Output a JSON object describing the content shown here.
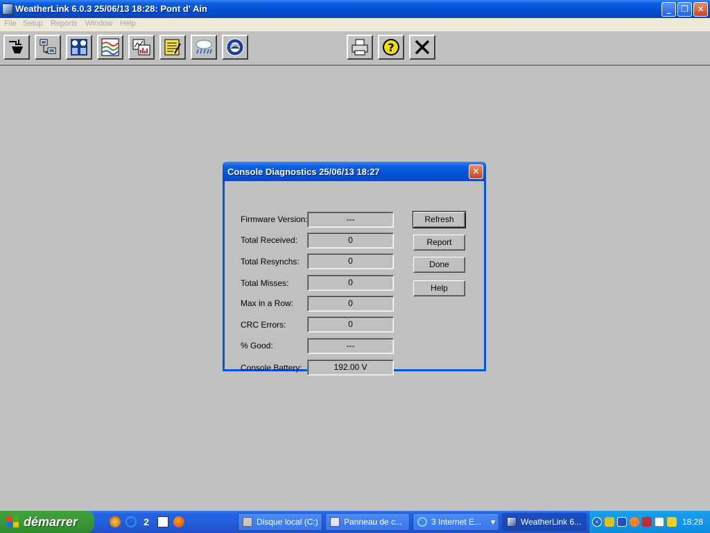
{
  "window": {
    "title": "WeatherLink 6.0.3  25/06/13  18:28: Pont d' Ain",
    "controls": {
      "minimize": "_",
      "restore": "❐",
      "close": "✕"
    }
  },
  "menu": [
    "File",
    "Setup",
    "Reports",
    "Window",
    "Help"
  ],
  "toolbar": {
    "left_icons": [
      "connect-icon",
      "download-icon",
      "bulletin-icon",
      "summary-graph-icon",
      "plot-graph-icon",
      "notes-icon",
      "rain-icon",
      "noaa-icon"
    ],
    "right_icons": [
      "print-icon",
      "help-icon",
      "exit-icon"
    ],
    "help_glyph": "?",
    "exit_glyph": "✕",
    "noaa_label": "NOAA"
  },
  "dialog": {
    "title": "Console Diagnostics  25/06/13  18:27",
    "close_glyph": "✕",
    "fields": [
      {
        "label": "Firmware Version:",
        "value": "---"
      },
      {
        "label": "Total Received:",
        "value": "0"
      },
      {
        "label": "Total Resynchs:",
        "value": "0"
      },
      {
        "label": "Total Misses:",
        "value": "0"
      },
      {
        "label": "Max in a Row:",
        "value": "0"
      },
      {
        "label": "CRC Errors:",
        "value": "0"
      },
      {
        "label": "% Good:",
        "value": "---"
      },
      {
        "label": "Console Battery:",
        "value": "192.00 V"
      }
    ],
    "buttons": [
      "Refresh",
      "Report",
      "Done",
      "Help"
    ]
  },
  "taskbar": {
    "start_label": "démarrer",
    "quicklaunch_badge": "2",
    "tasks": [
      {
        "label": "Disque local (C:)",
        "icon": "drive-icon"
      },
      {
        "label": "Panneau de c...",
        "icon": "control-panel-icon"
      },
      {
        "label": "3 Internet E...",
        "icon": "internet-explorer-icon"
      },
      {
        "label": "WeatherLink 6...",
        "icon": "weatherlink-icon"
      }
    ],
    "group_arrow": "▾",
    "tray_expand": "‹",
    "clock": "18:28"
  }
}
